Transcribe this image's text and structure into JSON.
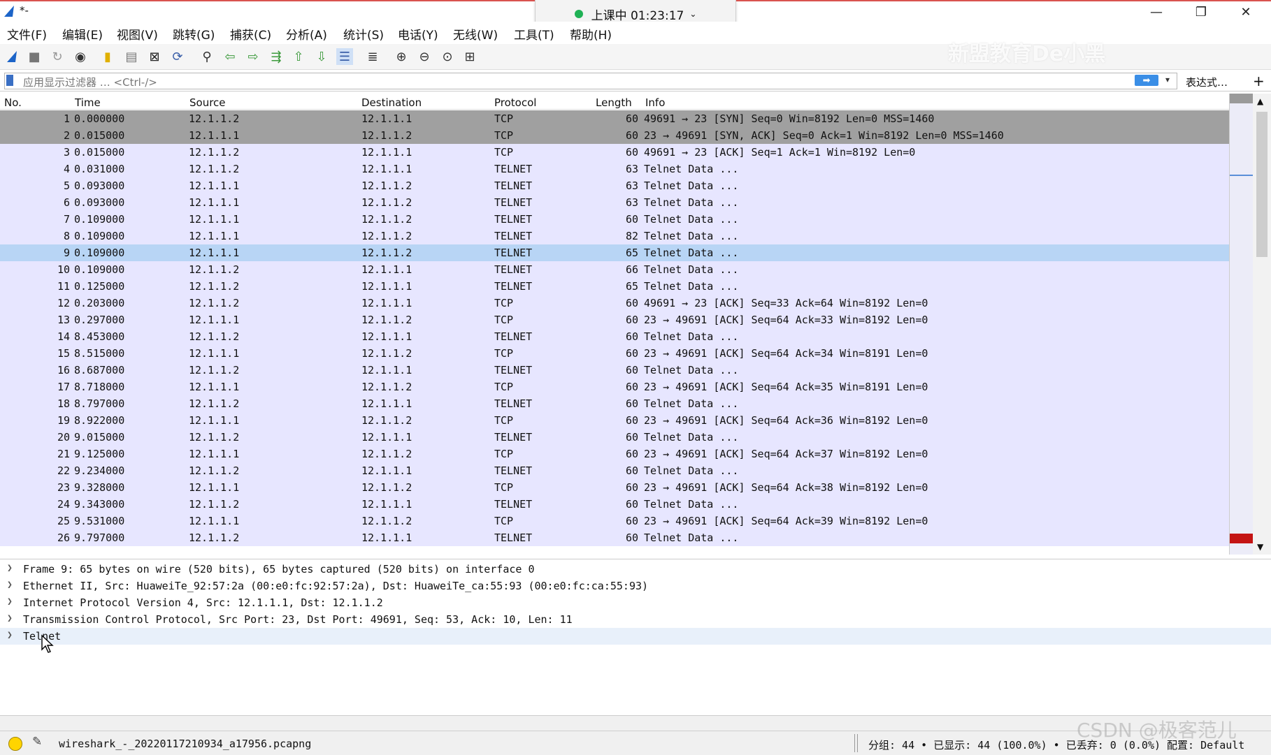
{
  "window": {
    "title": "*-",
    "minimize": "—",
    "maximize": "❐",
    "close": "✕"
  },
  "meeting": {
    "label": "上课中 01:23:17",
    "caret": "⌄"
  },
  "watermark_top": "新盟教育De小黑",
  "menu": [
    "文件(F)",
    "编辑(E)",
    "视图(V)",
    "跳转(G)",
    "捕获(C)",
    "分析(A)",
    "统计(S)",
    "电话(Y)",
    "无线(W)",
    "工具(T)",
    "帮助(H)"
  ],
  "filter": {
    "placeholder": "应用显示过滤器 … <Ctrl-/>",
    "apply": "➡",
    "dropdown": "▾",
    "expression": "表达式…",
    "plus": "+"
  },
  "columns": [
    "No.",
    "Time",
    "Source",
    "Destination",
    "Protocol",
    "Length",
    "Info"
  ],
  "packets": [
    {
      "no": "1",
      "time": "0.000000",
      "src": "12.1.1.2",
      "dst": "12.1.1.1",
      "proto": "TCP",
      "len": "60",
      "info": "49691 → 23 [SYN] Seq=0 Win=8192 Len=0 MSS=1460",
      "style": "syn"
    },
    {
      "no": "2",
      "time": "0.015000",
      "src": "12.1.1.1",
      "dst": "12.1.1.2",
      "proto": "TCP",
      "len": "60",
      "info": "23 → 49691 [SYN, ACK] Seq=0 Ack=1 Win=8192 Len=0 MSS=1460",
      "style": "syn"
    },
    {
      "no": "3",
      "time": "0.015000",
      "src": "12.1.1.2",
      "dst": "12.1.1.1",
      "proto": "TCP",
      "len": "60",
      "info": "49691 → 23 [ACK] Seq=1 Ack=1 Win=8192 Len=0",
      "style": "tcp"
    },
    {
      "no": "4",
      "time": "0.031000",
      "src": "12.1.1.2",
      "dst": "12.1.1.1",
      "proto": "TELNET",
      "len": "63",
      "info": "Telnet Data ...",
      "style": "tcp"
    },
    {
      "no": "5",
      "time": "0.093000",
      "src": "12.1.1.1",
      "dst": "12.1.1.2",
      "proto": "TELNET",
      "len": "63",
      "info": "Telnet Data ...",
      "style": "tcp"
    },
    {
      "no": "6",
      "time": "0.093000",
      "src": "12.1.1.1",
      "dst": "12.1.1.2",
      "proto": "TELNET",
      "len": "63",
      "info": "Telnet Data ...",
      "style": "tcp"
    },
    {
      "no": "7",
      "time": "0.109000",
      "src": "12.1.1.1",
      "dst": "12.1.1.2",
      "proto": "TELNET",
      "len": "60",
      "info": "Telnet Data ...",
      "style": "tcp"
    },
    {
      "no": "8",
      "time": "0.109000",
      "src": "12.1.1.1",
      "dst": "12.1.1.2",
      "proto": "TELNET",
      "len": "82",
      "info": "Telnet Data ...",
      "style": "tcp"
    },
    {
      "no": "9",
      "time": "0.109000",
      "src": "12.1.1.1",
      "dst": "12.1.1.2",
      "proto": "TELNET",
      "len": "65",
      "info": "Telnet Data ...",
      "style": "selected"
    },
    {
      "no": "10",
      "time": "0.109000",
      "src": "12.1.1.2",
      "dst": "12.1.1.1",
      "proto": "TELNET",
      "len": "66",
      "info": "Telnet Data ...",
      "style": "tcp"
    },
    {
      "no": "11",
      "time": "0.125000",
      "src": "12.1.1.2",
      "dst": "12.1.1.1",
      "proto": "TELNET",
      "len": "65",
      "info": "Telnet Data ...",
      "style": "tcp"
    },
    {
      "no": "12",
      "time": "0.203000",
      "src": "12.1.1.2",
      "dst": "12.1.1.1",
      "proto": "TCP",
      "len": "60",
      "info": "49691 → 23 [ACK] Seq=33 Ack=64 Win=8192 Len=0",
      "style": "tcp"
    },
    {
      "no": "13",
      "time": "0.297000",
      "src": "12.1.1.1",
      "dst": "12.1.1.2",
      "proto": "TCP",
      "len": "60",
      "info": "23 → 49691 [ACK] Seq=64 Ack=33 Win=8192 Len=0",
      "style": "tcp"
    },
    {
      "no": "14",
      "time": "8.453000",
      "src": "12.1.1.2",
      "dst": "12.1.1.1",
      "proto": "TELNET",
      "len": "60",
      "info": "Telnet Data ...",
      "style": "tcp"
    },
    {
      "no": "15",
      "time": "8.515000",
      "src": "12.1.1.1",
      "dst": "12.1.1.2",
      "proto": "TCP",
      "len": "60",
      "info": "23 → 49691 [ACK] Seq=64 Ack=34 Win=8191 Len=0",
      "style": "tcp"
    },
    {
      "no": "16",
      "time": "8.687000",
      "src": "12.1.1.2",
      "dst": "12.1.1.1",
      "proto": "TELNET",
      "len": "60",
      "info": "Telnet Data ...",
      "style": "tcp"
    },
    {
      "no": "17",
      "time": "8.718000",
      "src": "12.1.1.1",
      "dst": "12.1.1.2",
      "proto": "TCP",
      "len": "60",
      "info": "23 → 49691 [ACK] Seq=64 Ack=35 Win=8191 Len=0",
      "style": "tcp"
    },
    {
      "no": "18",
      "time": "8.797000",
      "src": "12.1.1.2",
      "dst": "12.1.1.1",
      "proto": "TELNET",
      "len": "60",
      "info": "Telnet Data ...",
      "style": "tcp"
    },
    {
      "no": "19",
      "time": "8.922000",
      "src": "12.1.1.1",
      "dst": "12.1.1.2",
      "proto": "TCP",
      "len": "60",
      "info": "23 → 49691 [ACK] Seq=64 Ack=36 Win=8192 Len=0",
      "style": "tcp"
    },
    {
      "no": "20",
      "time": "9.015000",
      "src": "12.1.1.2",
      "dst": "12.1.1.1",
      "proto": "TELNET",
      "len": "60",
      "info": "Telnet Data ...",
      "style": "tcp"
    },
    {
      "no": "21",
      "time": "9.125000",
      "src": "12.1.1.1",
      "dst": "12.1.1.2",
      "proto": "TCP",
      "len": "60",
      "info": "23 → 49691 [ACK] Seq=64 Ack=37 Win=8192 Len=0",
      "style": "tcp"
    },
    {
      "no": "22",
      "time": "9.234000",
      "src": "12.1.1.2",
      "dst": "12.1.1.1",
      "proto": "TELNET",
      "len": "60",
      "info": "Telnet Data ...",
      "style": "tcp"
    },
    {
      "no": "23",
      "time": "9.328000",
      "src": "12.1.1.1",
      "dst": "12.1.1.2",
      "proto": "TCP",
      "len": "60",
      "info": "23 → 49691 [ACK] Seq=64 Ack=38 Win=8192 Len=0",
      "style": "tcp"
    },
    {
      "no": "24",
      "time": "9.343000",
      "src": "12.1.1.2",
      "dst": "12.1.1.1",
      "proto": "TELNET",
      "len": "60",
      "info": "Telnet Data ...",
      "style": "tcp"
    },
    {
      "no": "25",
      "time": "9.531000",
      "src": "12.1.1.1",
      "dst": "12.1.1.2",
      "proto": "TCP",
      "len": "60",
      "info": "23 → 49691 [ACK] Seq=64 Ack=39 Win=8192 Len=0",
      "style": "tcp"
    },
    {
      "no": "26",
      "time": "9.797000",
      "src": "12.1.1.2",
      "dst": "12.1.1.1",
      "proto": "TELNET",
      "len": "60",
      "info": "Telnet Data ...",
      "style": "tcp"
    }
  ],
  "row_colors": {
    "syn": "#a0a0a0",
    "tcp": "#e7e6ff",
    "selected": "#b8d5f5"
  },
  "details": [
    "Frame 9: 65 bytes on wire (520 bits), 65 bytes captured (520 bits) on interface 0",
    "Ethernet II, Src: HuaweiTe_92:57:2a (00:e0:fc:92:57:2a), Dst: HuaweiTe_ca:55:93 (00:e0:fc:ca:55:93)",
    "Internet Protocol Version 4, Src: 12.1.1.1, Dst: 12.1.1.2",
    "Transmission Control Protocol, Src Port: 23, Dst Port: 49691, Seq: 53, Ack: 10, Len: 11",
    "Telnet"
  ],
  "status": {
    "file": "wireshark_-_20220117210934_a17956.pcapng",
    "stats": "分组: 44 • 已显示: 44 (100.0%) • 已丢弃: 0 (0.0%)   配置: Default",
    "watermark": "CSDN @极客范儿"
  }
}
